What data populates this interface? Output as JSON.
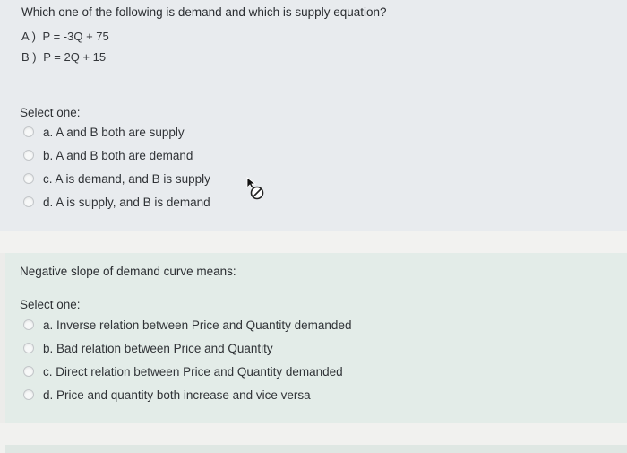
{
  "question1": {
    "text": "Which one of the following is demand and which is supply equation?",
    "equations": [
      {
        "label": "A )",
        "expr": "P = -3Q + 75"
      },
      {
        "label": "B )",
        "expr": "P = 2Q + 15"
      }
    ],
    "select_label": "Select one:",
    "options": [
      "a. A and B both are supply",
      "b. A and B both are demand",
      "c. A is demand, and B is supply",
      "d. A is supply, and B is demand"
    ]
  },
  "question2": {
    "text": "Negative slope of demand curve means:",
    "select_label": "Select one:",
    "options": [
      "a. Inverse relation between Price and Quantity demanded",
      "b. Bad relation between Price and Quantity",
      "c. Direct relation between Price and Quantity demanded",
      "d. Price and quantity both increase and vice versa"
    ]
  },
  "icons": {
    "cursor": "not-allowed-cursor-icon"
  }
}
